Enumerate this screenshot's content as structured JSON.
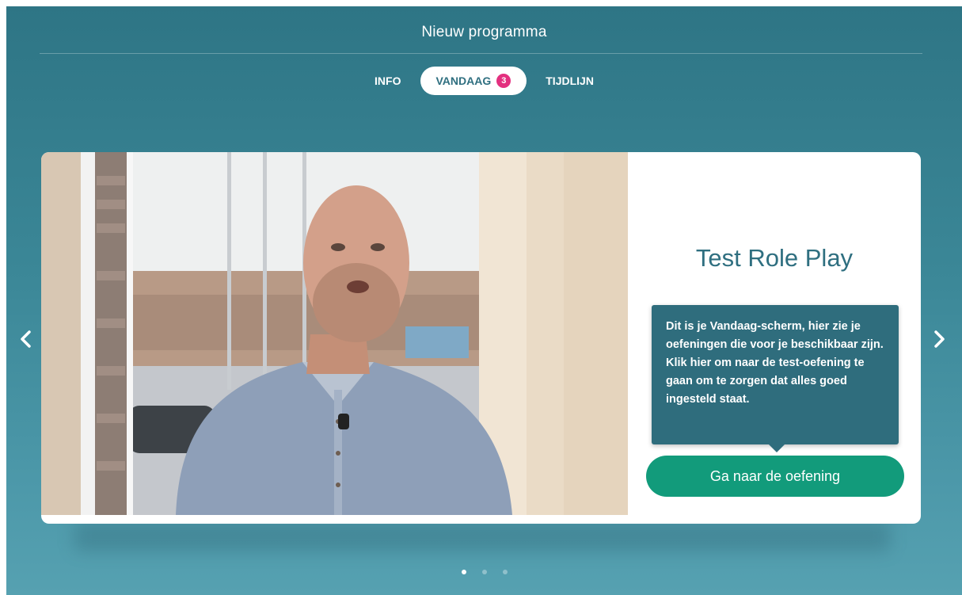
{
  "header": {
    "title": "Nieuw programma"
  },
  "tabs": [
    {
      "label": "INFO",
      "active": false
    },
    {
      "label": "VANDAAG",
      "active": true,
      "badge": "3"
    },
    {
      "label": "TIJDLIJN",
      "active": false
    }
  ],
  "exercise": {
    "title": "Test Role Play",
    "tooltip": {
      "part1": "Dit is je ",
      "bold": "Vandaag",
      "part2": "-scherm, hier zie je oefeningen die voor je beschikbaar zijn. Klik hier om naar de test-oefening te gaan om te zorgen dat alles goed ingesteld staat."
    },
    "button_label": "Ga naar de oefening"
  },
  "carousel": {
    "page_count": 3,
    "current_page": 1,
    "prev_icon": "chevron-left-icon",
    "next_icon": "chevron-right-icon"
  },
  "colors": {
    "background": "#3b8797",
    "accent": "#2f6f80",
    "badge": "#e3307f",
    "button": "#129b7b"
  }
}
